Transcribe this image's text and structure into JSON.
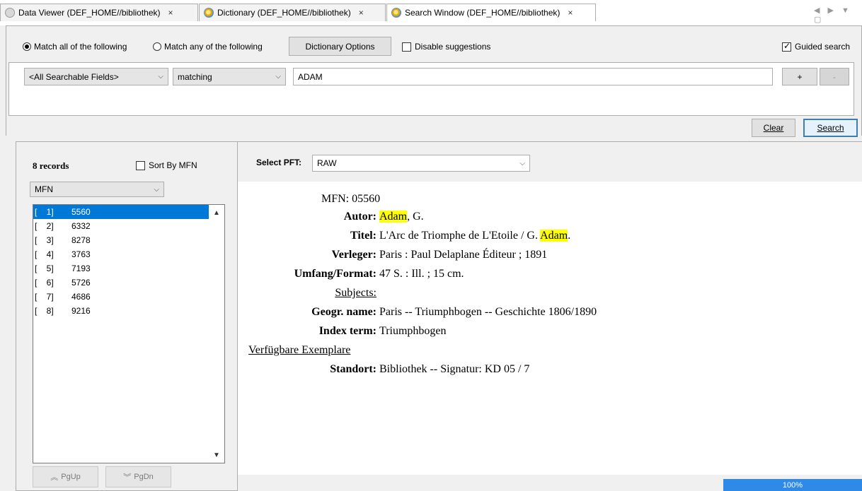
{
  "tabs": [
    {
      "label": "Data Viewer (DEF_HOME//bibliothek)",
      "close": "×"
    },
    {
      "label": "Dictionary (DEF_HOME//bibliothek)",
      "close": "×"
    },
    {
      "label": "Search Window (DEF_HOME//bibliothek)",
      "close": "×"
    }
  ],
  "tab_nav": "◀ ▶ ▼ ▢",
  "search": {
    "match_all_label": "Match all of the following",
    "match_any_label": "Match any of the following",
    "match_mode": "all",
    "dictionary_options_label": "Dictionary Options",
    "disable_suggestions_label": "Disable suggestions",
    "disable_suggestions_checked": false,
    "guided_search_label": "Guided search",
    "guided_search_checked": true,
    "field_select": "<All Searchable Fields>",
    "operator_select": "matching",
    "query_value": "ADAM",
    "add_label": "+",
    "remove_label": "-",
    "clear_label": "Clear",
    "search_label": "Search"
  },
  "results": {
    "count_label": "8 records",
    "sort_by_mfn_label": "Sort By MFN",
    "sort_by_mfn_checked": false,
    "sort_field": "MFN",
    "records": [
      {
        "idx": "[    1]",
        "mfn": "5560"
      },
      {
        "idx": "[    2]",
        "mfn": "6332"
      },
      {
        "idx": "[    3]",
        "mfn": "8278"
      },
      {
        "idx": "[    4]",
        "mfn": "3763"
      },
      {
        "idx": "[    5]",
        "mfn": "7193"
      },
      {
        "idx": "[    6]",
        "mfn": "5726"
      },
      {
        "idx": "[    7]",
        "mfn": "4686"
      },
      {
        "idx": "[    8]",
        "mfn": "9216"
      }
    ],
    "selected_index": 0,
    "pgup_label": "PgUp",
    "pgdn_label": "PgDn"
  },
  "display": {
    "select_pft_label": "Select PFT:",
    "pft_value": "RAW",
    "mfn_line": "MFN: 05560",
    "autor_label": "Autor:",
    "autor_hl": "Adam",
    "autor_rest": ", G.",
    "titel_label": "Titel:",
    "titel_text": "L'Arc de Triomphe de L'Etoile / G.",
    "titel_hl": "Adam",
    "titel_end": ".",
    "verleger_label": "Verleger:",
    "verleger_value": "Paris : Paul Delaplane Éditeur ; 1891",
    "umfang_label": "Umfang/Format:",
    "umfang_value": "47 S. : Ill. ; 15 cm.",
    "subjects_label": "Subjects:",
    "geogr_label": "Geogr. name:",
    "geogr_value": "Paris -- Triumphbogen -- Geschichte 1806/1890",
    "index_label": "Index term:",
    "index_value": "Triumphbogen",
    "exemplare_label": "Verfügbare Exemplare",
    "standort_label": "Standort:",
    "standort_value": "Bibliothek -- Signatur: KD 05 / 7"
  },
  "progress": {
    "label": "100%",
    "value": 1.0
  }
}
